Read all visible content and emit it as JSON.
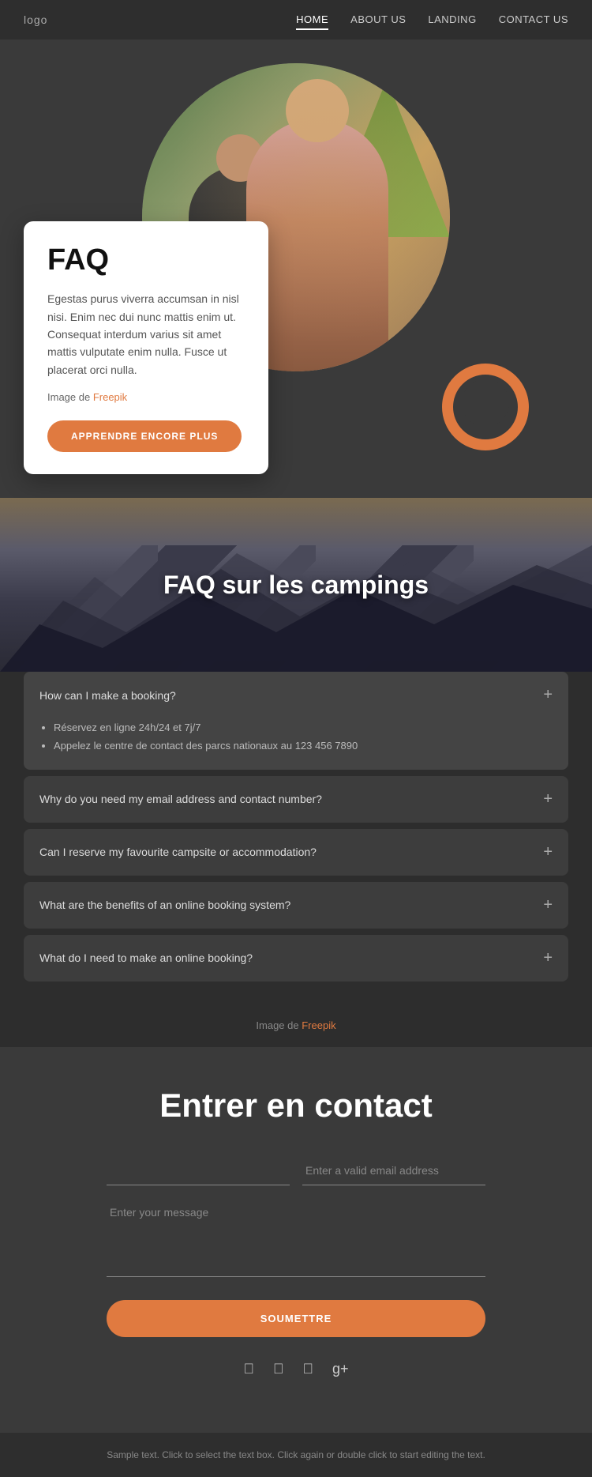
{
  "nav": {
    "logo": "logo",
    "links": [
      {
        "label": "HOME",
        "active": true
      },
      {
        "label": "ABOUT US",
        "active": false
      },
      {
        "label": "LANDING",
        "active": false
      },
      {
        "label": "CONTACT US",
        "active": false
      }
    ]
  },
  "hero": {
    "card": {
      "title": "FAQ",
      "description": "Egestas purus viverra accumsan in nisl nisi. Enim nec dui nunc mattis enim ut. Consequat interdum varius sit amet mattis vulputate enim nulla. Fusce ut placerat orci nulla.",
      "image_credit_prefix": "Image de ",
      "image_credit_link": "Freepik",
      "button_label": "APPRENDRE ENCORE PLUS"
    }
  },
  "faq_camping": {
    "title": "FAQ sur les campings",
    "items": [
      {
        "id": 1,
        "question": "How can I make a booking?",
        "expanded": true,
        "answers": [
          "Réservez en ligne 24h/24 et 7j/7",
          "Appelez le centre de contact des parcs nationaux au 123 456 7890"
        ]
      },
      {
        "id": 2,
        "question": "Why do you need my email address and contact number?",
        "expanded": false,
        "answers": []
      },
      {
        "id": 3,
        "question": "Can I reserve my favourite campsite or accommodation?",
        "expanded": false,
        "answers": []
      },
      {
        "id": 4,
        "question": "What are the benefits of an online booking system?",
        "expanded": false,
        "answers": []
      },
      {
        "id": 5,
        "question": "What do I need to make an online booking?",
        "expanded": false,
        "answers": []
      }
    ],
    "image_credit_prefix": "Image de ",
    "image_credit_link": "Freepik"
  },
  "contact": {
    "title": "Entrer en contact",
    "name_placeholder": "",
    "email_placeholder": "Enter a valid email address",
    "message_placeholder": "Enter your message",
    "submit_label": "SOUMETTRE"
  },
  "social": {
    "icons": [
      "f",
      "t",
      "ig",
      "g+"
    ]
  },
  "footer": {
    "text": "Sample text. Click to select the text box. Click again or double\nclick to start editing the text."
  }
}
